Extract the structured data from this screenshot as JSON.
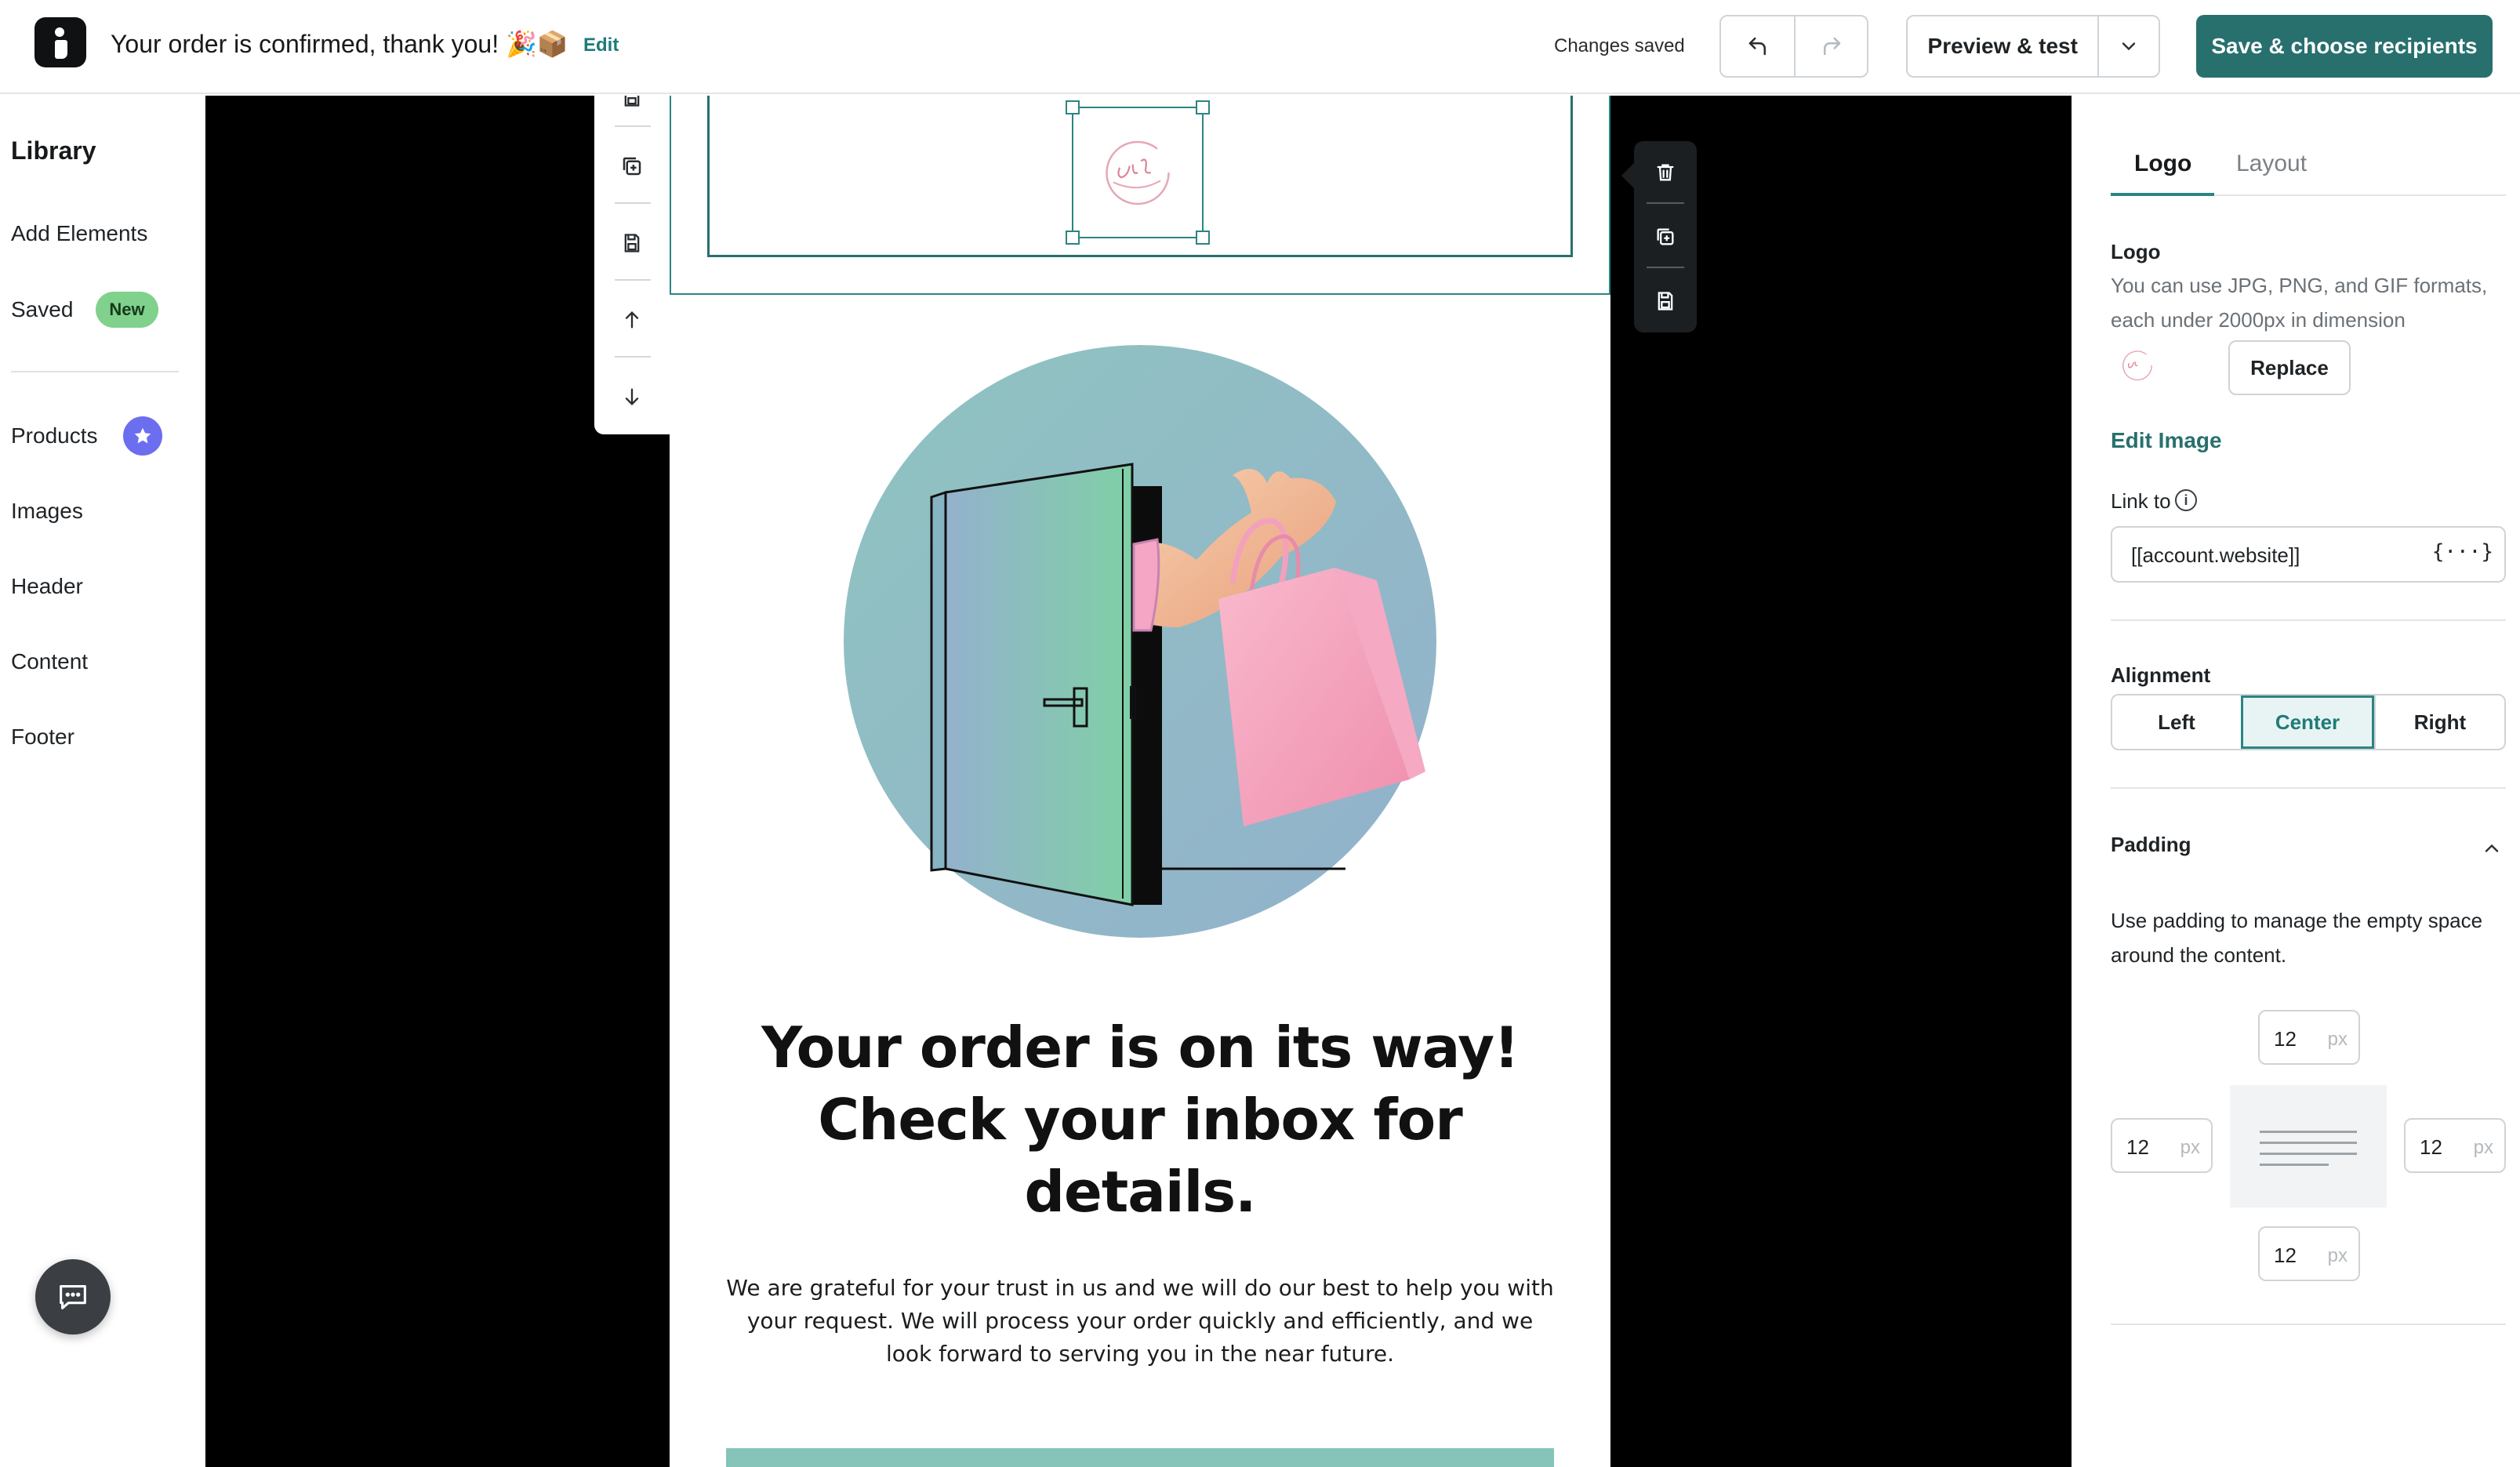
{
  "topbar": {
    "email_title": "Your order is confirmed, thank you! 🎉📦",
    "edit_link": "Edit",
    "status": "Changes saved",
    "preview_label": "Preview & test",
    "save_label": "Save & choose recipients"
  },
  "library": {
    "title": "Library",
    "items": [
      "Add Elements",
      "Saved",
      "Products",
      "Images",
      "Header",
      "Content",
      "Footer"
    ],
    "new_badge": "New"
  },
  "email": {
    "headline": "Your order is on its way! Check your inbox for details.",
    "body": "We are grateful for your trust in us and we will do our best to help you with your request. We will process your order quickly and efficiently, and we look forward to serving you in the near future."
  },
  "panel": {
    "tabs": [
      "Logo",
      "Layout"
    ],
    "active_tab": "Logo",
    "logo_label": "Logo",
    "logo_help": "You can use JPG, PNG, and GIF formats, each under 2000px in dimension",
    "replace_label": "Replace",
    "edit_image_label": "Edit Image",
    "link_label": "Link to",
    "link_value": "[[account.website]]",
    "alignment_label": "Alignment",
    "alignment_options": [
      "Left",
      "Center",
      "Right"
    ],
    "alignment_selected": "Center",
    "padding_label": "Padding",
    "padding_help": "Use padding to manage the empty space around the content.",
    "padding": {
      "top": "12",
      "left": "12",
      "right": "12",
      "bottom": "12",
      "unit": "px"
    }
  },
  "colors": {
    "accent": "#28706e",
    "badge_new": "#7fd18b",
    "star_badge": "#6c6ef0",
    "canvas_background": "#000000"
  },
  "icons": [
    "undo-icon",
    "redo-icon",
    "chevron-down-icon",
    "star-icon",
    "chat-icon",
    "trash-icon",
    "duplicate-icon",
    "save-block-icon",
    "arrow-up-icon",
    "arrow-down-icon",
    "info-icon",
    "merge-tag-icon",
    "chevron-up-icon"
  ]
}
